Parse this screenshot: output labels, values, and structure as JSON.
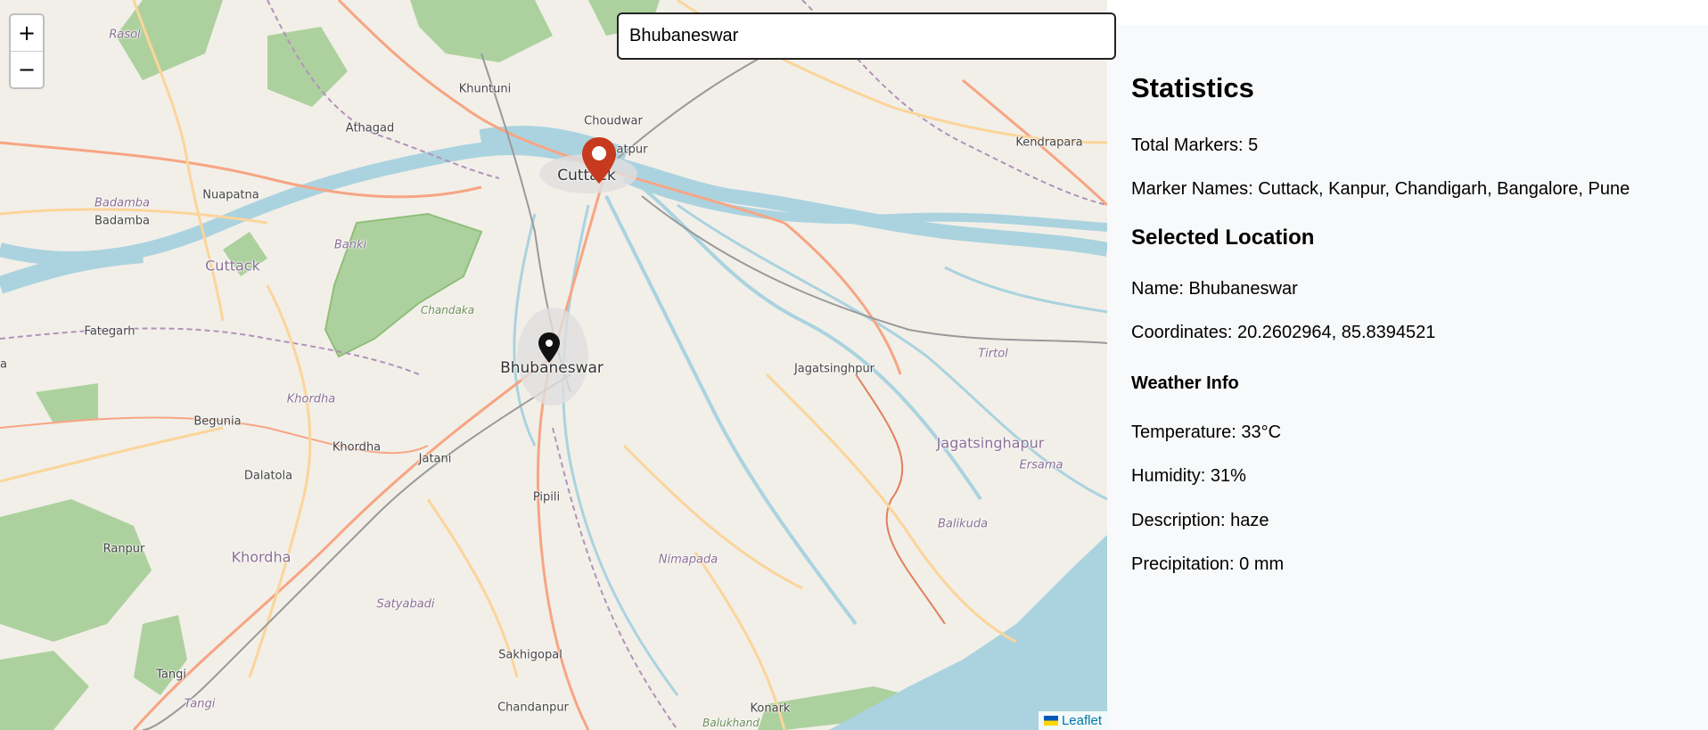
{
  "search": {
    "value": "Bhubaneswar"
  },
  "zoom": {
    "in_label": "+",
    "out_label": "−"
  },
  "map": {
    "attribution": "Leaflet",
    "labels": {
      "rasol": "Rasol",
      "khuntuni": "Khuntuni",
      "choudwar": "Choudwar",
      "athagad": "Athagad",
      "cuttack_city": "Cuttack",
      "kendrapara": "Kendrapara",
      "badamba_italic": "Badamba",
      "badamba": "Badamba",
      "nuapatna": "Nuapatna",
      "cuttack_district": "Cuttack",
      "banki": "Banki",
      "fategarh": "Fategarh",
      "chandaka": "Chandaka",
      "bhubaneswar": "Bhubaneswar",
      "jagatsinghpur": "Jagatsinghpur",
      "tirtol": "Tirtol",
      "khordha_italic": "Khordha",
      "begunia": "Begunia",
      "khordha": "Khordha",
      "jatani": "Jatani",
      "dalatola": "Dalatola",
      "jagatsinghapur": "Jagatsinghapur",
      "ersama": "Ersama",
      "pipili": "Pipili",
      "balikuda": "Balikuda",
      "ranpur": "Ranpur",
      "khordha_district": "Khordha",
      "nimapada": "Nimapada",
      "satyabadi": "Satyabadi",
      "sakhigopal": "Sakhigopal",
      "tangi": "Tangi",
      "tangi_italic": "Tangi",
      "chandanpur": "Chandanpur",
      "konark": "Konark",
      "balukhand": "Balukhand",
      "atpur": "atpur",
      "a": "a"
    }
  },
  "statistics": {
    "heading": "Statistics",
    "total_markers": "Total Markers: 5",
    "marker_names": "Marker Names: Cuttack, Kanpur, Chandigarh, Bangalore, Pune"
  },
  "selected": {
    "heading": "Selected Location",
    "name": "Name: Bhubaneswar",
    "coordinates": "Coordinates: 20.2602964, 85.8394521"
  },
  "weather": {
    "heading": "Weather Info",
    "temperature": "Temperature: 33°C",
    "humidity": "Humidity: 31%",
    "description": "Description: haze",
    "precipitation": "Precipitation: 0 mm"
  },
  "colors": {
    "map_land": "#f2efe9",
    "water": "#aad3df",
    "forest": "#add19e",
    "primary_road": "#f7a583",
    "secondary_road": "#fbd59a",
    "railway": "#999999",
    "district_border": "#b193b8",
    "marker_red": "#c73a1f",
    "sidebar_bg": "#f8f9fa",
    "link": "#0078a8"
  }
}
